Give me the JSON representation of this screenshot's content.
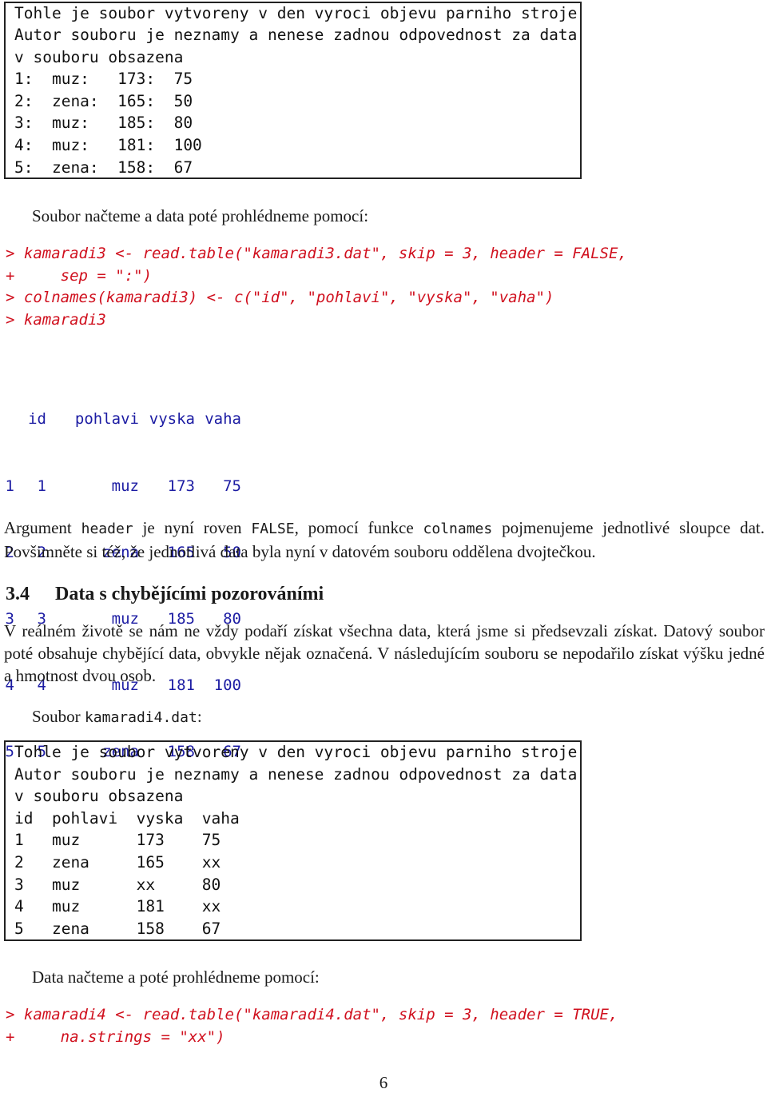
{
  "file3_box": {
    "lines": [
      "Tohle je soubor vytvoreny v den vyroci objevu parniho stroje",
      "Autor souboru je neznamy a nenese zadnou odpovednost za data",
      "v souboru obsazena",
      "1:  muz:   173:  75",
      "2:  zena:  165:  50",
      "3:  muz:   185:  80",
      "4:  muz:   181:  100",
      "5:  zena:  158:  67"
    ]
  },
  "intro1": "Soubor načteme a data poté prohlédneme pomocí:",
  "code1": [
    "> kamaradi3 <- read.table(\"kamaradi3.dat\", skip = 3, header = FALSE,",
    "+     sep = \":\")",
    "> colnames(kamaradi3) <- c(\"id\", \"pohlavi\", \"vyska\", \"vaha\")",
    "> kamaradi3"
  ],
  "output1": {
    "columns": [
      "",
      "id",
      "pohlavi",
      "vyska",
      "vaha"
    ],
    "rows": [
      [
        "1",
        "1",
        "muz",
        "173",
        "75"
      ],
      [
        "2",
        "2",
        "zena",
        "165",
        "50"
      ],
      [
        "3",
        "3",
        "muz",
        "185",
        "80"
      ],
      [
        "4",
        "4",
        "muz",
        "181",
        "100"
      ],
      [
        "5",
        "5",
        "zena",
        "158",
        "67"
      ]
    ]
  },
  "explain": {
    "t1": "Argument ",
    "code_a": "header",
    "t2": " je nyní roven ",
    "code_b": "FALSE",
    "t3": ", pomocí funkce ",
    "code_c": "colnames",
    "t4": " pojmenujeme jednotlivé sloupce dat. Povšimněte si též, že jednotlivá data byla nyní v datovém souboru oddělena dvojtečkou."
  },
  "section": {
    "number": "3.4",
    "title": "Data s chybějícími pozorováními"
  },
  "section_text": "V reálném životě se nám ne vždy podaří získat všechna data, která jsme si předsevzali získat. Datový soubor poté obsahuje chybějící data, obvykle nějak označená. V následujícím souboru se nepodařilo získat výšku jedné a hmotnost dvou osob.",
  "file4_label": {
    "prefix": "Soubor ",
    "filename": "kamaradi4.dat",
    "suffix": ":"
  },
  "file4_box": {
    "lines": [
      "Tohle je soubor vytvoreny v den vyroci objevu parniho stroje",
      "Autor souboru je neznamy a nenese zadnou odpovednost za data",
      "v souboru obsazena",
      "id  pohlavi  vyska  vaha",
      "1   muz      173    75",
      "2   zena     165    xx",
      "3   muz      xx     80",
      "4   muz      181    xx",
      "5   zena     158    67"
    ]
  },
  "intro2": "Data načteme a poté prohlédneme pomocí:",
  "code2": [
    "> kamaradi4 <- read.table(\"kamaradi4.dat\", skip = 3, header = TRUE,",
    "+     na.strings = \"xx\")"
  ],
  "page_number": "6",
  "colors": {
    "code_red": "#d0101e",
    "output_blue": "#1c1ca3"
  }
}
